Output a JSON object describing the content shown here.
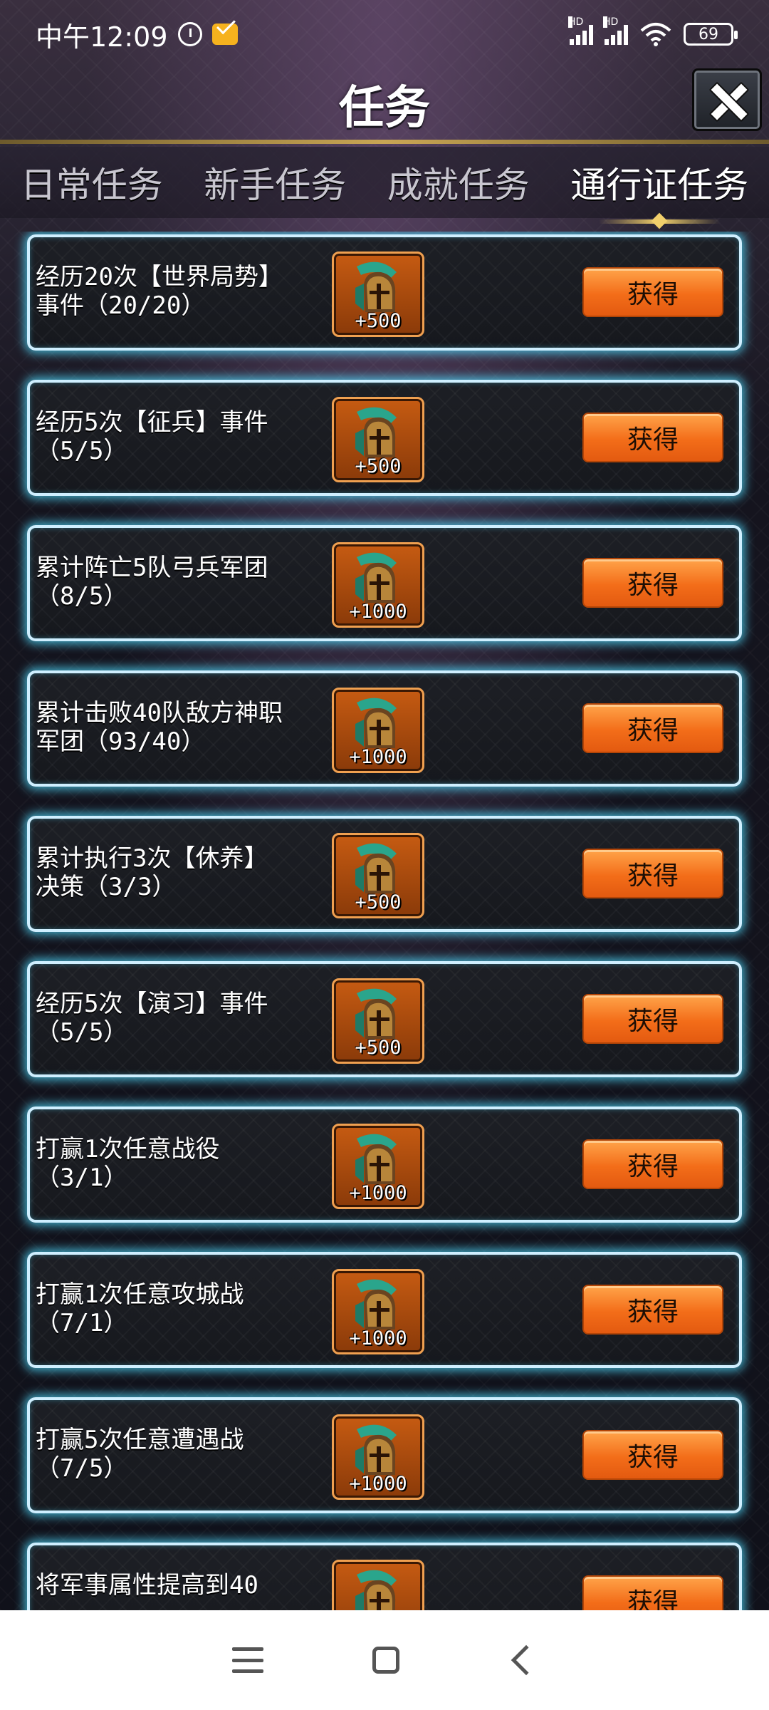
{
  "status_bar": {
    "time": "中午12:09",
    "signal_tag_1": "HD",
    "signal_tag_2": "HD",
    "battery": "69"
  },
  "header": {
    "title": "任务"
  },
  "tabs": [
    {
      "label": "日常任务",
      "active": false
    },
    {
      "label": "新手任务",
      "active": false
    },
    {
      "label": "成就任务",
      "active": false
    },
    {
      "label": "通行证任务",
      "active": true
    }
  ],
  "tasks": [
    {
      "text": "经历20次【世界局势】事件（20/20）",
      "line1": "经历20次【世界局势】",
      "line2": "事件（20/20）",
      "reward": "+500",
      "button": "获得"
    },
    {
      "text": "经历5次【征兵】事件（5/5）",
      "line1": "经历5次【征兵】事件",
      "line2": "（5/5）",
      "reward": "+500",
      "button": "获得"
    },
    {
      "text": "累计阵亡5队弓兵军团（8/5）",
      "line1": "累计阵亡5队弓兵军团",
      "line2": "（8/5）",
      "reward": "+1000",
      "button": "获得"
    },
    {
      "text": "累计击败40队敌方神职军团（93/40）",
      "line1": "累计击败40队敌方神职",
      "line2": "军团（93/40）",
      "reward": "+1000",
      "button": "获得"
    },
    {
      "text": "累计执行3次【休养】决策（3/3）",
      "line1": "累计执行3次【休养】",
      "line2": "决策（3/3）",
      "reward": "+500",
      "button": "获得"
    },
    {
      "text": "经历5次【演习】事件（5/5）",
      "line1": "经历5次【演习】事件",
      "line2": "（5/5）",
      "reward": "+500",
      "button": "获得"
    },
    {
      "text": "打赢1次任意战役（3/1）",
      "line1": "打赢1次任意战役",
      "line2": "（3/1）",
      "reward": "+1000",
      "button": "获得"
    },
    {
      "text": "打赢1次任意攻城战（7/1）",
      "line1": "打赢1次任意攻城战",
      "line2": "（7/1）",
      "reward": "+1000",
      "button": "获得"
    },
    {
      "text": "打赢5次任意遭遇战（7/5）",
      "line1": "打赢5次任意遭遇战",
      "line2": "（7/5）",
      "reward": "+1000",
      "button": "获得"
    },
    {
      "text": "将军事属性提高到40",
      "line1": "将军事属性提高到40",
      "line2": "",
      "reward": "",
      "button": "获得"
    }
  ],
  "colors": {
    "card_glow": "#50dcff",
    "claim_button": "#f36d19",
    "reward_bg": "#c65b12",
    "accent_gold": "#f1cf6b"
  },
  "icons": {
    "reward": "helmet-icon",
    "close": "close-icon"
  }
}
